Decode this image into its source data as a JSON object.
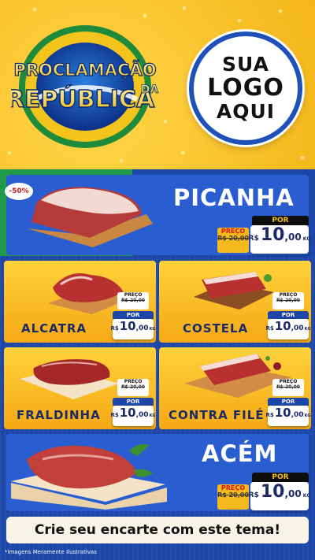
{
  "header": {
    "title_line1": "PROCLAMAÇÃO",
    "title_line2": "REPÚBLICA",
    "title_da": "DA",
    "logo_placeholder": [
      "SUA",
      "LOGO",
      "AQUI"
    ]
  },
  "badge": {
    "discount": "-50%"
  },
  "products": [
    {
      "name": "PICANHA",
      "por": "POR",
      "preco_label": "PREÇO",
      "old_price": "R$ 20,00",
      "currency": "R$",
      "price_int": "10",
      "price_dec": ",00",
      "unit": "KG"
    },
    {
      "name": "ALCATRA",
      "por": "POR",
      "preco_label": "PREÇO",
      "old_price": "R$ 20,00",
      "currency": "R$",
      "price_int": "10",
      "price_dec": ",00",
      "unit": "KG"
    },
    {
      "name": "COSTELA",
      "por": "POR",
      "preco_label": "PREÇO",
      "old_price": "R$ 20,00",
      "currency": "R$",
      "price_int": "10",
      "price_dec": ",00",
      "unit": "KG"
    },
    {
      "name": "FRALDINHA",
      "por": "POR",
      "preco_label": "PREÇO",
      "old_price": "R$ 20,00",
      "currency": "R$",
      "price_int": "10",
      "price_dec": ",00",
      "unit": "KG"
    },
    {
      "name": "CONTRA FILÉ",
      "por": "POR",
      "preco_label": "PREÇO",
      "old_price": "R$ 20,00",
      "currency": "R$",
      "price_int": "10",
      "price_dec": ",00",
      "unit": "KG"
    },
    {
      "name": "ACÉM",
      "por": "POR",
      "preco_label": "PREÇO",
      "old_price": "R$ 20,00",
      "currency": "R$",
      "price_int": "10",
      "price_dec": ",00",
      "unit": "KG"
    }
  ],
  "footer": {
    "cta": "Crie seu encarte com este tema!",
    "note": "*Imagens Meramente Ilustrativas"
  },
  "colors": {
    "brand_blue": "#1c46a8",
    "brand_green": "#1e9a4a",
    "brand_yellow": "#f6b91c"
  }
}
